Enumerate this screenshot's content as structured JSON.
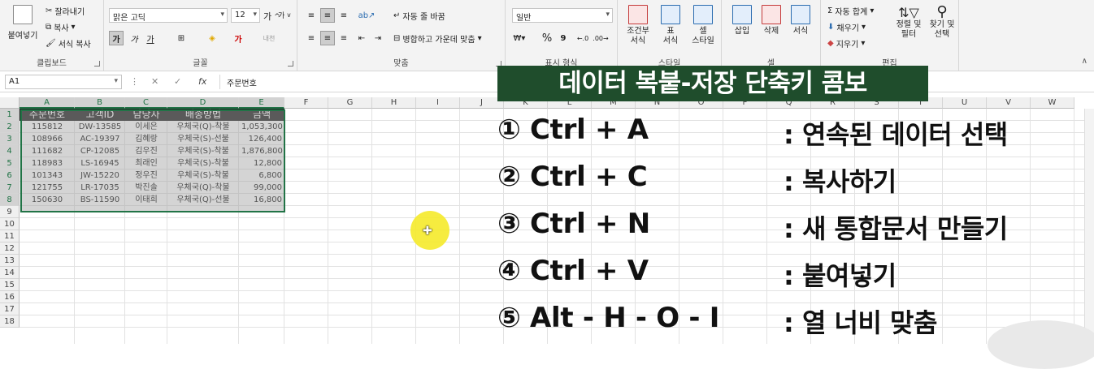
{
  "ribbon": {
    "clipboard": {
      "paste": "붙여넣기",
      "cut": "잘라내기",
      "copy": "복사",
      "format_painter": "서식 복사",
      "label": "클립보드"
    },
    "font": {
      "font_name": "맑은 고딕",
      "font_size": "12",
      "grow": "가",
      "shrink": "가",
      "bold": "가",
      "italic": "가",
      "underline": "가",
      "label": "글꼴"
    },
    "alignment": {
      "wrap_text": "자동 줄 바꿈",
      "merge_center": "병합하고 가운데 맞춤",
      "label": "맞춤"
    },
    "number": {
      "format": "일반",
      "percent": "%",
      "comma": "9",
      "label": "표시 형식"
    },
    "styles": {
      "conditional": "조건부\n서식",
      "table": "표\n서식",
      "cell_style": "셀\n스타일",
      "label": "스타일"
    },
    "cells": {
      "insert": "삽입",
      "delete": "삭제",
      "format": "서식",
      "label": "셀"
    },
    "editing": {
      "autosum": "자동 합계",
      "fill": "채우기",
      "clear": "지우기",
      "sort_filter": "정렬 및\n필터",
      "find_select": "찾기 및\n선택",
      "label": "편집"
    }
  },
  "formula_bar": {
    "name_box": "A1",
    "fx": "fx",
    "content": "주문번호"
  },
  "columns": [
    "A",
    "B",
    "C",
    "D",
    "E",
    "F",
    "G",
    "H",
    "I",
    "J",
    "K",
    "L",
    "M",
    "N",
    "O",
    "P",
    "Q",
    "R",
    "S",
    "T",
    "U",
    "V",
    "W"
  ],
  "rows": [
    "1",
    "2",
    "3",
    "4",
    "5",
    "6",
    "7",
    "8",
    "9",
    "10",
    "11",
    "12",
    "13",
    "14",
    "15",
    "16",
    "17",
    "18"
  ],
  "table": {
    "headers": [
      "주문번호",
      "고객ID",
      "담당자",
      "배송방법",
      "금액"
    ],
    "rows": [
      [
        "115812",
        "DW-13585",
        "이세은",
        "우체국(Q)-착불",
        "1,053,300"
      ],
      [
        "108966",
        "AC-19397",
        "김혜랑",
        "우체국(S)-선불",
        "126,400"
      ],
      [
        "111682",
        "CP-12085",
        "김우진",
        "우체국(S)-착불",
        "1,876,800"
      ],
      [
        "118983",
        "LS-16945",
        "최래인",
        "우체국(S)-착불",
        "12,800"
      ],
      [
        "101343",
        "JW-15220",
        "정우진",
        "우체국(S)-착불",
        "6,800"
      ],
      [
        "121755",
        "LR-17035",
        "박진솔",
        "우체국(Q)-착불",
        "99,000"
      ],
      [
        "150630",
        "BS-11590",
        "이태희",
        "우체국(Q)-선불",
        "16,800"
      ]
    ]
  },
  "overlay": {
    "title": "데이터 복붙-저장 단축키 콤보",
    "shortcuts": [
      {
        "key": "① Ctrl + A",
        "desc": ": 연속된 데이터 선택"
      },
      {
        "key": "② Ctrl + C",
        "desc": ": 복사하기"
      },
      {
        "key": "③ Ctrl + N",
        "desc": ": 새 통합문서 만들기"
      },
      {
        "key": "④ Ctrl + V",
        "desc": ": 붙여넣기"
      },
      {
        "key": "⑤ Alt - H - O - I",
        "desc": ": 열 너비 맞춤"
      }
    ]
  },
  "colors": {
    "excel_green": "#217346",
    "banner_bg": "#1f4d2c",
    "cursor_highlight": "#f5ea2a"
  }
}
